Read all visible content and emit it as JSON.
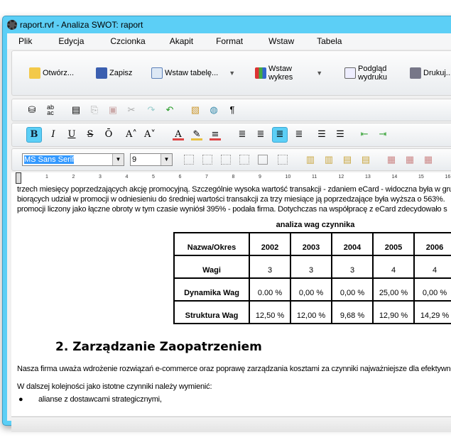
{
  "window": {
    "title": "raport.rvf - Analiza SWOT:   raport"
  },
  "menu": [
    "Plik",
    "Edycja",
    "Czcionka",
    "Akapit",
    "Format",
    "Wstaw",
    "Tabela"
  ],
  "toolbar": {
    "open": "Otwórz...",
    "save": "Zapisz",
    "insert_table": "Wstaw tabelę...",
    "insert_chart_1": "Wstaw",
    "insert_chart_2": "wykres",
    "preview_1": "Podgląd",
    "preview_2": "wydruku",
    "print": "Drukuj..."
  },
  "format": {
    "font": "MS Sans Serif",
    "size": "9",
    "bold": "B",
    "italic": "I",
    "underline": "U",
    "strike": "S",
    "overline": "Ō",
    "pilcrow": "¶"
  },
  "ruler": [
    "1",
    "2",
    "3",
    "4",
    "5",
    "6",
    "7",
    "8",
    "9",
    "10",
    "11",
    "12",
    "13",
    "14",
    "15",
    "16"
  ],
  "doc": {
    "lines": [
      "trzech miesięcy poprzedzających akcję promocyjną. Szczególnie wysoka wartość transakcji - zdaniem eCard - widoczna była w gru",
      "biorących udział w promocji w odniesieniu do średniej wartości transakcji za trzy miesiące ją poprzedzające była wyższa o 563%.",
      "promocji liczony jako łączne obroty w tym czasie wyniósł 395% - podała firma. Dotychczas na współpracę z eCard zdecydowało s"
    ],
    "table": {
      "caption": "analiza wag czynnika",
      "header": [
        "Nazwa/Okres",
        "2002",
        "2003",
        "2004",
        "2005",
        "2006"
      ],
      "rows": [
        [
          "Wagi",
          "3",
          "3",
          "3",
          "4",
          "4"
        ],
        [
          "Dynamika Wag",
          "0.00 %",
          "0,00 %",
          "0,00 %",
          "25,00 %",
          "0,00 %"
        ],
        [
          "Struktura Wag",
          "12,50 %",
          "12,00 %",
          "9,68 %",
          "12,90 %",
          "14,29 %"
        ]
      ]
    },
    "heading": "2. Zarządzanie Zaopatrzeniem",
    "para1": "Nasza firma uważa wdrożenie rozwiązań e-commerce oraz poprawę zarządzania kosztami za czynniki najważniejsze dla efektywneg",
    "para2": "W dalszej kolejności jako istotne czynniki należy wymienić:",
    "bullet": "alianse z dostawcami strategicznymi,"
  },
  "colors": {
    "accent": "#5ccff6"
  }
}
